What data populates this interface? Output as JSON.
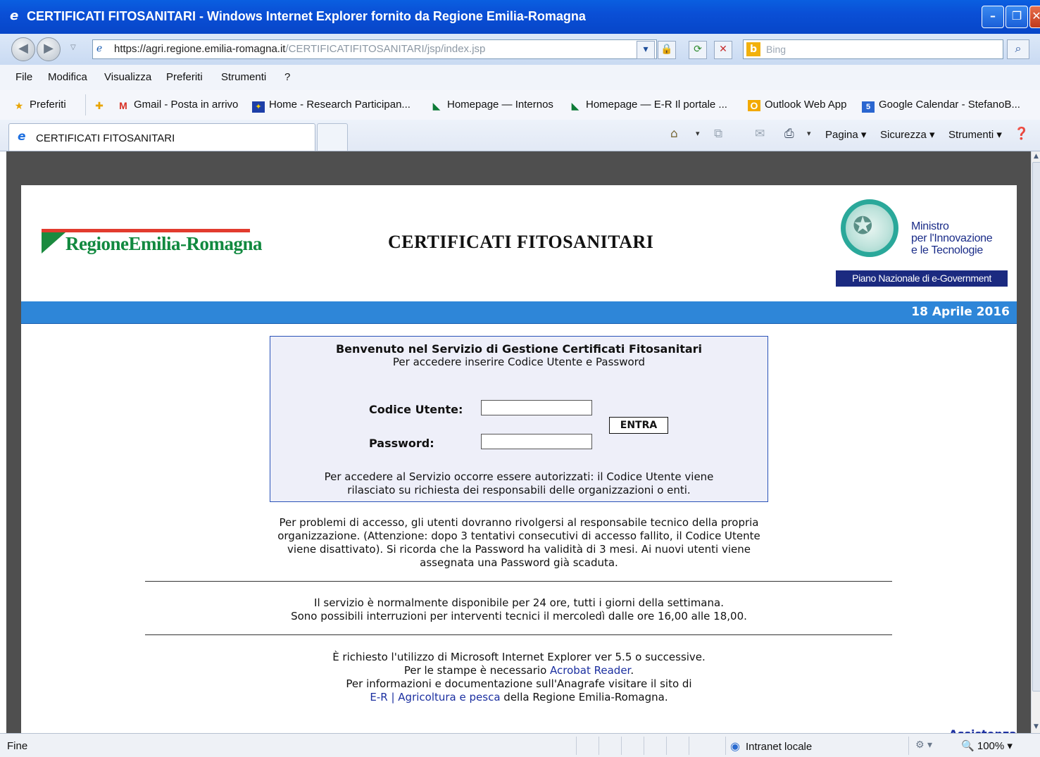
{
  "window": {
    "title": "CERTIFICATI FITOSANITARI - Windows Internet Explorer fornito da Regione Emilia-Romagna"
  },
  "address": {
    "url_main": "https://agri.regione.emilia-romagna.it",
    "url_rest": "/CERTIFICATIFITOSANITARI/jsp/index.jsp",
    "search_placeholder": "Bing"
  },
  "menu": {
    "file": "File",
    "modifica": "Modifica",
    "visualizza": "Visualizza",
    "preferiti": "Preferiti",
    "strumenti": "Strumenti",
    "help": "?"
  },
  "favorites": {
    "preferiti": "Preferiti",
    "items": [
      "Gmail - Posta in arrivo",
      "Home - Research Participan...",
      "Homepage — Internos",
      "Homepage — E-R Il portale ...",
      "Outlook Web App",
      "Google Calendar - StefanoB..."
    ]
  },
  "tabs": {
    "active": "CERTIFICATI FITOSANITARI"
  },
  "commands": {
    "pagina": "Pagina",
    "sicurezza": "Sicurezza",
    "strumenti": "Strumenti"
  },
  "page": {
    "logo_text": "RegioneEmilia-Romagna",
    "title": "CERTIFICATI FITOSANITARI",
    "ministry": {
      "line1": "Ministro",
      "line2": "per l'Innovazione",
      "line3": "e le Tecnologie",
      "band": "Piano Nazionale di e-Government"
    },
    "date": "18 Aprile 2016",
    "login": {
      "welcome": "Benvenuto nel Servizio di Gestione Certificati Fitosanitari",
      "instructions": "Per accedere inserire Codice Utente e Password",
      "user_label": "Codice Utente:",
      "password_label": "Password:",
      "user_value": "",
      "password_value": "",
      "submit": "ENTRA",
      "auth_line1": "Per accedere al Servizio occorre essere autorizzati: il Codice Utente viene",
      "auth_line2": "rilasciato su richiesta dei responsabili delle organizzazioni o enti."
    },
    "problems": {
      "line1": "Per problemi di accesso, gli utenti dovranno rivolgersi al responsabile tecnico della propria",
      "line2": "organizzazione. (Attenzione: dopo 3 tentativi consecutivi di accesso fallito, il Codice Utente",
      "line3": "viene disattivato). Si ricorda che la Password ha validità di 3 mesi. Ai nuovi utenti viene",
      "line4": "assegnata una Password già scaduta."
    },
    "service": {
      "line1": "Il servizio è normalmente disponibile per 24 ore, tutti i giorni della settimana.",
      "line2": "Sono possibili interruzioni per interventi tecnici il mercoledì dalle ore 16,00 alle 18,00."
    },
    "requirements": {
      "line1": "È richiesto l'utilizzo di Microsoft Internet Explorer ver 5.5 o successive.",
      "line2_pre": "Per le stampe è necessario ",
      "line2_link": "Acrobat Reader",
      "line2_post": ".",
      "line3": "Per informazioni e documentazione sull'Anagrafe visitare il sito di",
      "line4_link": "E-R | Agricoltura e pesca",
      "line4_post": " della Regione Emilia-Romagna."
    },
    "assistenza": "Assistenza"
  },
  "status": {
    "text": "Fine",
    "zone": "Intranet locale",
    "zoom": "100%"
  },
  "colors": {
    "title_bar": "#0a4fd6",
    "band": "#2e86d8",
    "login_border": "#2a52b8",
    "logo_green": "#11893f",
    "ministry_blue": "#1b2a80"
  }
}
